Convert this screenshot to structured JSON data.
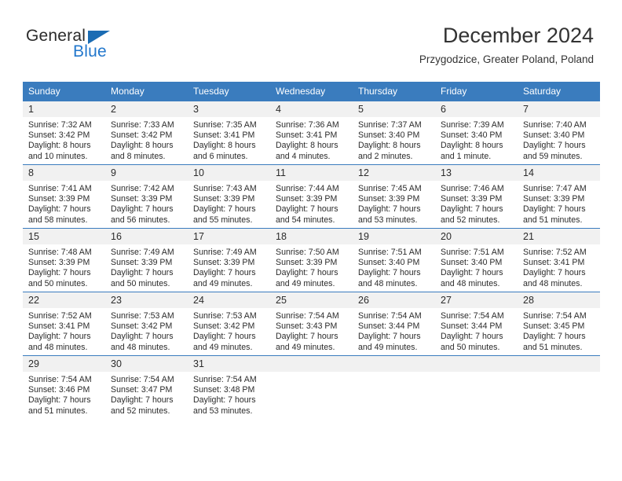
{
  "brand": {
    "name_part1": "General",
    "name_part2": "Blue",
    "triangle_color": "#1b6cb3",
    "blue_text_color": "#2277cc"
  },
  "header": {
    "title": "December 2024",
    "subtitle": "Przygodzice, Greater Poland, Poland"
  },
  "colors": {
    "header_blue": "#3a7cbe",
    "daynum_band": "#f1f1f1",
    "text": "#2b2b2b"
  },
  "weekdays": [
    "Sunday",
    "Monday",
    "Tuesday",
    "Wednesday",
    "Thursday",
    "Friday",
    "Saturday"
  ],
  "weeks": [
    [
      {
        "day": "1",
        "sunrise": "Sunrise: 7:32 AM",
        "sunset": "Sunset: 3:42 PM",
        "daylight_line1": "Daylight: 8 hours",
        "daylight_line2": "and 10 minutes."
      },
      {
        "day": "2",
        "sunrise": "Sunrise: 7:33 AM",
        "sunset": "Sunset: 3:42 PM",
        "daylight_line1": "Daylight: 8 hours",
        "daylight_line2": "and 8 minutes."
      },
      {
        "day": "3",
        "sunrise": "Sunrise: 7:35 AM",
        "sunset": "Sunset: 3:41 PM",
        "daylight_line1": "Daylight: 8 hours",
        "daylight_line2": "and 6 minutes."
      },
      {
        "day": "4",
        "sunrise": "Sunrise: 7:36 AM",
        "sunset": "Sunset: 3:41 PM",
        "daylight_line1": "Daylight: 8 hours",
        "daylight_line2": "and 4 minutes."
      },
      {
        "day": "5",
        "sunrise": "Sunrise: 7:37 AM",
        "sunset": "Sunset: 3:40 PM",
        "daylight_line1": "Daylight: 8 hours",
        "daylight_line2": "and 2 minutes."
      },
      {
        "day": "6",
        "sunrise": "Sunrise: 7:39 AM",
        "sunset": "Sunset: 3:40 PM",
        "daylight_line1": "Daylight: 8 hours",
        "daylight_line2": "and 1 minute."
      },
      {
        "day": "7",
        "sunrise": "Sunrise: 7:40 AM",
        "sunset": "Sunset: 3:40 PM",
        "daylight_line1": "Daylight: 7 hours",
        "daylight_line2": "and 59 minutes."
      }
    ],
    [
      {
        "day": "8",
        "sunrise": "Sunrise: 7:41 AM",
        "sunset": "Sunset: 3:39 PM",
        "daylight_line1": "Daylight: 7 hours",
        "daylight_line2": "and 58 minutes."
      },
      {
        "day": "9",
        "sunrise": "Sunrise: 7:42 AM",
        "sunset": "Sunset: 3:39 PM",
        "daylight_line1": "Daylight: 7 hours",
        "daylight_line2": "and 56 minutes."
      },
      {
        "day": "10",
        "sunrise": "Sunrise: 7:43 AM",
        "sunset": "Sunset: 3:39 PM",
        "daylight_line1": "Daylight: 7 hours",
        "daylight_line2": "and 55 minutes."
      },
      {
        "day": "11",
        "sunrise": "Sunrise: 7:44 AM",
        "sunset": "Sunset: 3:39 PM",
        "daylight_line1": "Daylight: 7 hours",
        "daylight_line2": "and 54 minutes."
      },
      {
        "day": "12",
        "sunrise": "Sunrise: 7:45 AM",
        "sunset": "Sunset: 3:39 PM",
        "daylight_line1": "Daylight: 7 hours",
        "daylight_line2": "and 53 minutes."
      },
      {
        "day": "13",
        "sunrise": "Sunrise: 7:46 AM",
        "sunset": "Sunset: 3:39 PM",
        "daylight_line1": "Daylight: 7 hours",
        "daylight_line2": "and 52 minutes."
      },
      {
        "day": "14",
        "sunrise": "Sunrise: 7:47 AM",
        "sunset": "Sunset: 3:39 PM",
        "daylight_line1": "Daylight: 7 hours",
        "daylight_line2": "and 51 minutes."
      }
    ],
    [
      {
        "day": "15",
        "sunrise": "Sunrise: 7:48 AM",
        "sunset": "Sunset: 3:39 PM",
        "daylight_line1": "Daylight: 7 hours",
        "daylight_line2": "and 50 minutes."
      },
      {
        "day": "16",
        "sunrise": "Sunrise: 7:49 AM",
        "sunset": "Sunset: 3:39 PM",
        "daylight_line1": "Daylight: 7 hours",
        "daylight_line2": "and 50 minutes."
      },
      {
        "day": "17",
        "sunrise": "Sunrise: 7:49 AM",
        "sunset": "Sunset: 3:39 PM",
        "daylight_line1": "Daylight: 7 hours",
        "daylight_line2": "and 49 minutes."
      },
      {
        "day": "18",
        "sunrise": "Sunrise: 7:50 AM",
        "sunset": "Sunset: 3:39 PM",
        "daylight_line1": "Daylight: 7 hours",
        "daylight_line2": "and 49 minutes."
      },
      {
        "day": "19",
        "sunrise": "Sunrise: 7:51 AM",
        "sunset": "Sunset: 3:40 PM",
        "daylight_line1": "Daylight: 7 hours",
        "daylight_line2": "and 48 minutes."
      },
      {
        "day": "20",
        "sunrise": "Sunrise: 7:51 AM",
        "sunset": "Sunset: 3:40 PM",
        "daylight_line1": "Daylight: 7 hours",
        "daylight_line2": "and 48 minutes."
      },
      {
        "day": "21",
        "sunrise": "Sunrise: 7:52 AM",
        "sunset": "Sunset: 3:41 PM",
        "daylight_line1": "Daylight: 7 hours",
        "daylight_line2": "and 48 minutes."
      }
    ],
    [
      {
        "day": "22",
        "sunrise": "Sunrise: 7:52 AM",
        "sunset": "Sunset: 3:41 PM",
        "daylight_line1": "Daylight: 7 hours",
        "daylight_line2": "and 48 minutes."
      },
      {
        "day": "23",
        "sunrise": "Sunrise: 7:53 AM",
        "sunset": "Sunset: 3:42 PM",
        "daylight_line1": "Daylight: 7 hours",
        "daylight_line2": "and 48 minutes."
      },
      {
        "day": "24",
        "sunrise": "Sunrise: 7:53 AM",
        "sunset": "Sunset: 3:42 PM",
        "daylight_line1": "Daylight: 7 hours",
        "daylight_line2": "and 49 minutes."
      },
      {
        "day": "25",
        "sunrise": "Sunrise: 7:54 AM",
        "sunset": "Sunset: 3:43 PM",
        "daylight_line1": "Daylight: 7 hours",
        "daylight_line2": "and 49 minutes."
      },
      {
        "day": "26",
        "sunrise": "Sunrise: 7:54 AM",
        "sunset": "Sunset: 3:44 PM",
        "daylight_line1": "Daylight: 7 hours",
        "daylight_line2": "and 49 minutes."
      },
      {
        "day": "27",
        "sunrise": "Sunrise: 7:54 AM",
        "sunset": "Sunset: 3:44 PM",
        "daylight_line1": "Daylight: 7 hours",
        "daylight_line2": "and 50 minutes."
      },
      {
        "day": "28",
        "sunrise": "Sunrise: 7:54 AM",
        "sunset": "Sunset: 3:45 PM",
        "daylight_line1": "Daylight: 7 hours",
        "daylight_line2": "and 51 minutes."
      }
    ],
    [
      {
        "day": "29",
        "sunrise": "Sunrise: 7:54 AM",
        "sunset": "Sunset: 3:46 PM",
        "daylight_line1": "Daylight: 7 hours",
        "daylight_line2": "and 51 minutes."
      },
      {
        "day": "30",
        "sunrise": "Sunrise: 7:54 AM",
        "sunset": "Sunset: 3:47 PM",
        "daylight_line1": "Daylight: 7 hours",
        "daylight_line2": "and 52 minutes."
      },
      {
        "day": "31",
        "sunrise": "Sunrise: 7:54 AM",
        "sunset": "Sunset: 3:48 PM",
        "daylight_line1": "Daylight: 7 hours",
        "daylight_line2": "and 53 minutes."
      },
      {
        "day": "",
        "sunrise": "",
        "sunset": "",
        "daylight_line1": "",
        "daylight_line2": ""
      },
      {
        "day": "",
        "sunrise": "",
        "sunset": "",
        "daylight_line1": "",
        "daylight_line2": ""
      },
      {
        "day": "",
        "sunrise": "",
        "sunset": "",
        "daylight_line1": "",
        "daylight_line2": ""
      },
      {
        "day": "",
        "sunrise": "",
        "sunset": "",
        "daylight_line1": "",
        "daylight_line2": ""
      }
    ]
  ]
}
